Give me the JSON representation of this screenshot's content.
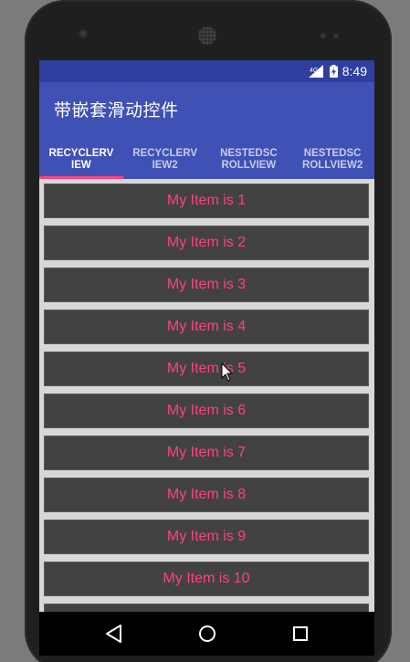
{
  "status_bar": {
    "network": "4G",
    "time": "8:49"
  },
  "app_bar": {
    "title": "带嵌套滑动控件"
  },
  "tabs": [
    {
      "label": "RECYCLERV\nIEW",
      "active": true
    },
    {
      "label": "RECYCLERV\nIEW2",
      "active": false
    },
    {
      "label": "NESTEDSC\nROLLVIEW",
      "active": false
    },
    {
      "label": "NESTEDSC\nROLLVIEW2",
      "active": false
    }
  ],
  "list": {
    "items": [
      "My Item is 1",
      "My Item is 2",
      "My Item is 3",
      "My Item is 4",
      "My Item is 5",
      "My Item is 6",
      "My Item is 7",
      "My Item is 8",
      "My Item is 9",
      "My Item is 10",
      ""
    ]
  },
  "nav_bar": {
    "icons": [
      "back-icon",
      "home-icon",
      "recents-icon"
    ]
  },
  "colors": {
    "primary": "#3f51b5",
    "primary_dark": "#303f9f",
    "accent": "#ff4081",
    "item_bg": "#424242",
    "list_bg": "#d7d7d7"
  }
}
